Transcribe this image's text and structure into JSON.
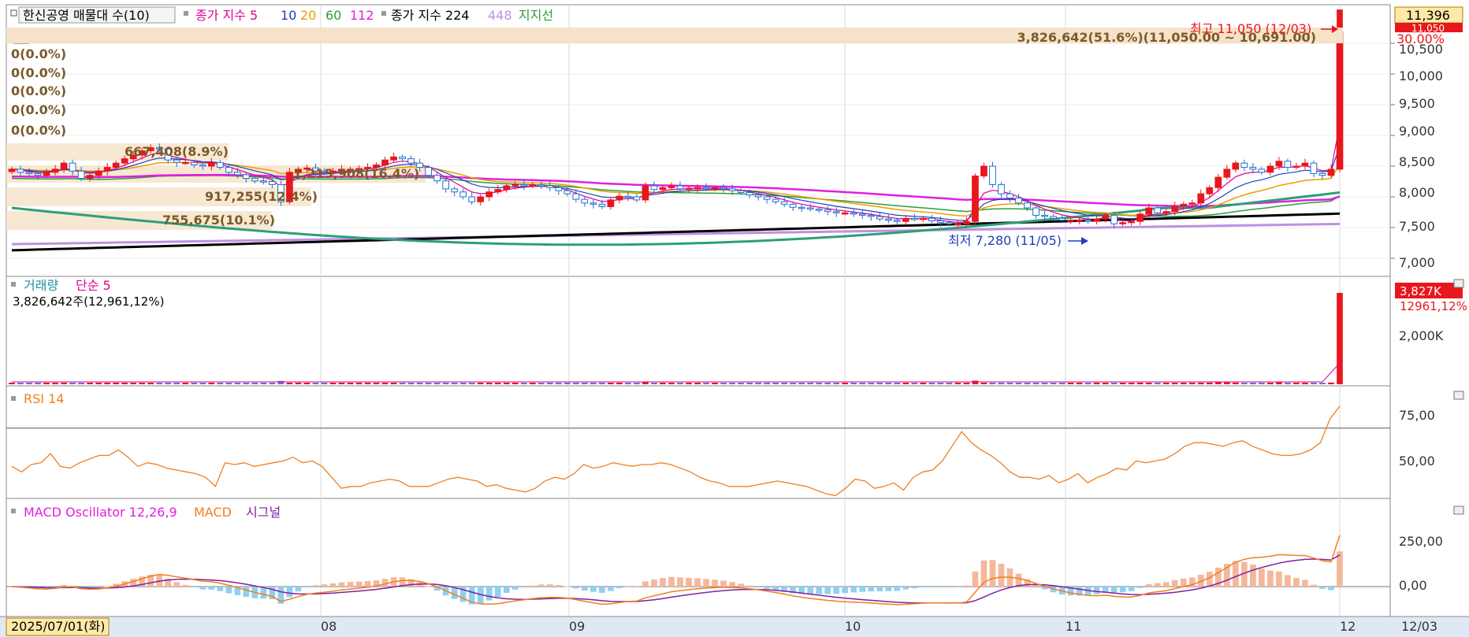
{
  "price_pane": {
    "legend": [
      {
        "text": "한신공영 매물대 수(10)",
        "color": "#000000"
      },
      {
        "text": "종가 지수 5",
        "color": "#e0009a"
      },
      {
        "text": "10",
        "color": "#1f3fbf"
      },
      {
        "text": "20",
        "color": "#e8a000"
      },
      {
        "text": "60",
        "color": "#2e9e3a"
      },
      {
        "text": "112",
        "color": "#e020e0"
      },
      {
        "text": "종가 지수 224",
        "color": "#000000"
      },
      {
        "text": "448",
        "color": "#c090e0"
      },
      {
        "text": "지지선",
        "color": "#2e9e3a"
      }
    ],
    "side_labels": [
      "0(0.0%)",
      "0(0.0%)",
      "0(0.0%)",
      "0(0.0%)",
      "0(0.0%)"
    ],
    "top_band_label": "3,826,642(51.6%)(11,050.00 ~ 10,691.00)",
    "band_labels": [
      "667,408(8.9%)",
      "1,215,908(16.4%)",
      "917,255(12.4%)",
      "755,675(10.1%)"
    ],
    "high_label": "최고 11,050 (12/03)",
    "low_label": "최저 7,280 (11/05)",
    "yticks": [
      "10,500",
      "10,000",
      "9,500",
      "9,000",
      "8,500",
      "8,000",
      "7,500",
      "7,000"
    ],
    "current_price": "11,396",
    "current_price2": "11,050",
    "current_pct": "30.00%"
  },
  "volume_pane": {
    "title": "거래량",
    "ma_label": "단순 5",
    "value_label": "3,826,642주(12,961,12%)",
    "ytick": "2,000K",
    "badge": "3,827K",
    "badge2": "12961,12%"
  },
  "rsi_pane": {
    "title": "RSI 14",
    "yticks": [
      "75,00",
      "50,00"
    ]
  },
  "macd_pane": {
    "title": "MACD Oscillator 12,26,9",
    "macd_label": "MACD",
    "signal_label": "시그널",
    "yticks": [
      "250,00",
      "0,00"
    ]
  },
  "xaxis": {
    "start_label": "2025/07/01(화)",
    "month_labels": [
      "08",
      "09",
      "10",
      "11",
      "12"
    ],
    "end_label": "12/03"
  },
  "colors": {
    "up": "#e8171d",
    "down": "#1f6fd0",
    "rsi": "#f07f20",
    "macd": "#f07f20",
    "signal": "#8020a0",
    "osc_pos": "#f5b79a",
    "osc_neg": "#8fd0f0",
    "band": "#f5e2c8"
  },
  "chart_data": [
    {
      "type": "candlestick",
      "title": "한신공영",
      "x": [
        "2025-07-01",
        "2025-12-03"
      ],
      "ylim": [
        6900,
        11100
      ],
      "high": {
        "value": 11050,
        "date": "12/03"
      },
      "low": {
        "value": 7280,
        "date": "11/05"
      },
      "close": [
        8450,
        8400,
        8380,
        8350,
        8400,
        8450,
        8550,
        8420,
        8300,
        8350,
        8420,
        8480,
        8550,
        8620,
        8680,
        8750,
        8800,
        8780,
        8600,
        8560,
        8560,
        8520,
        8500,
        8560,
        8480,
        8400,
        8360,
        8300,
        8260,
        8250,
        8200,
        7920,
        8400,
        8450,
        8470,
        8420,
        8400,
        8420,
        8450,
        8450,
        8460,
        8480,
        8520,
        8600,
        8650,
        8620,
        8550,
        8480,
        8350,
        8260,
        8130,
        8080,
        8000,
        7920,
        8000,
        8080,
        8120,
        8180,
        8200,
        8180,
        8200,
        8180,
        8150,
        8100,
        8050,
        7960,
        7900,
        7880,
        7840,
        7950,
        8010,
        8000,
        7950,
        8180,
        8120,
        8150,
        8180,
        8130,
        8140,
        8150,
        8140,
        8150,
        8130,
        8100,
        8070,
        8030,
        8000,
        7960,
        7920,
        7880,
        7830,
        7820,
        7800,
        7790,
        7760,
        7740,
        7740,
        7720,
        7700,
        7680,
        7640,
        7620,
        7600,
        7650,
        7640,
        7650,
        7610,
        7580,
        7560,
        7560,
        7600,
        8340,
        8500,
        8200,
        8050,
        7980,
        7900,
        7820,
        7700,
        7680,
        7650,
        7620,
        7620,
        7620,
        7600,
        7640,
        7700,
        7560,
        7580,
        7600,
        7720,
        7820,
        7740,
        7760,
        7850,
        7880,
        7900,
        8050,
        8150,
        8320,
        8450,
        8550,
        8480,
        8450,
        8400,
        8500,
        8580,
        8480,
        8500,
        8550,
        8380,
        8350,
        8450,
        10691
      ],
      "ma_series": [
        {
          "name": "5",
          "color": "#e0009a"
        },
        {
          "name": "10",
          "color": "#1f3fbf"
        },
        {
          "name": "20",
          "color": "#e8a000"
        },
        {
          "name": "60",
          "color": "#2e9e3a"
        },
        {
          "name": "112",
          "color": "#e020e0"
        },
        {
          "name": "224",
          "color": "#000000"
        },
        {
          "name": "448",
          "color": "#c090e0"
        },
        {
          "name": "지지선",
          "color": "#2e9e3a"
        }
      ]
    },
    {
      "type": "bar",
      "title": "거래량",
      "last_value": 3826642,
      "values": [
        30000,
        25000,
        20000,
        22000,
        28000,
        30000,
        25000,
        20000,
        18000,
        22000,
        24000,
        26000,
        30000,
        28000,
        26000,
        24000,
        22000,
        20000,
        22000,
        24000,
        25000,
        22000,
        20000,
        18000,
        20000,
        22000,
        24000,
        20000,
        18000,
        22000,
        25000,
        140000,
        40000,
        30000,
        28000,
        26000,
        24000,
        22000,
        24000,
        26000,
        28000,
        30000,
        25000,
        22000,
        20000,
        18000,
        20000,
        22000,
        40000,
        30000,
        22000,
        20000,
        35000,
        30000,
        25000,
        22000,
        20000,
        22000,
        24000,
        26000,
        28000,
        24000,
        22000,
        20000,
        22000,
        25000,
        30000,
        28000,
        26000,
        22000,
        20000,
        22000,
        24000,
        110000,
        30000,
        25000,
        22000,
        60000,
        24000,
        22000,
        20000,
        24000,
        26000,
        60000,
        30000,
        28000,
        26000,
        24000,
        22000,
        20000,
        22000,
        24000,
        26000,
        28000,
        30000,
        28000,
        26000,
        40000,
        30000,
        28000,
        26000,
        24000,
        22000,
        45000,
        30000,
        28000,
        26000,
        24000,
        22000,
        40000,
        60000,
        150000,
        60000,
        40000,
        30000,
        28000,
        26000,
        24000,
        22000,
        24000,
        26000,
        28000,
        30000,
        28000,
        26000,
        24000,
        26000,
        40000,
        30000,
        28000,
        60000,
        40000,
        30000,
        28000,
        50000,
        40000,
        30000,
        60000,
        70000,
        90000,
        80000,
        70000,
        60000,
        50000,
        40000,
        60000,
        80000,
        60000,
        50000,
        40000,
        30000,
        60000,
        70000,
        3826642
      ]
    },
    {
      "type": "line",
      "title": "RSI 14",
      "ylim": [
        25,
        100
      ],
      "values": [
        49,
        46,
        50,
        51,
        56,
        49,
        48,
        51,
        53,
        55,
        55,
        58,
        54,
        49,
        51,
        50,
        48,
        47,
        46,
        45,
        43,
        38,
        51,
        50,
        51,
        49,
        50,
        51,
        52,
        54,
        51,
        52,
        49,
        43,
        37,
        38,
        38,
        40,
        41,
        42,
        41,
        38,
        38,
        38,
        40,
        42,
        43,
        42,
        41,
        38,
        39,
        37,
        36,
        35,
        37,
        41,
        43,
        42,
        45,
        50,
        48,
        49,
        51,
        50,
        49,
        50,
        50,
        51,
        50,
        48,
        46,
        43,
        41,
        40,
        38,
        38,
        38,
        39,
        40,
        41,
        40,
        39,
        38,
        36,
        34,
        33,
        37,
        42,
        41,
        37,
        38,
        40,
        36,
        43,
        46,
        47,
        52,
        60,
        68,
        62,
        58,
        55,
        51,
        46,
        43,
        43,
        42,
        44,
        40,
        42,
        45,
        40,
        43,
        45,
        48,
        47,
        52,
        51,
        52,
        53,
        56,
        60,
        62,
        62,
        61,
        60,
        62,
        63,
        60,
        58,
        56,
        55,
        55,
        56,
        58,
        62,
        75,
        82
      ]
    },
    {
      "type": "line",
      "title": "MACD Oscillator 12,26,9",
      "series_names": [
        "MACD",
        "시그널"
      ],
      "ylim": [
        -60,
        400
      ]
    }
  ]
}
